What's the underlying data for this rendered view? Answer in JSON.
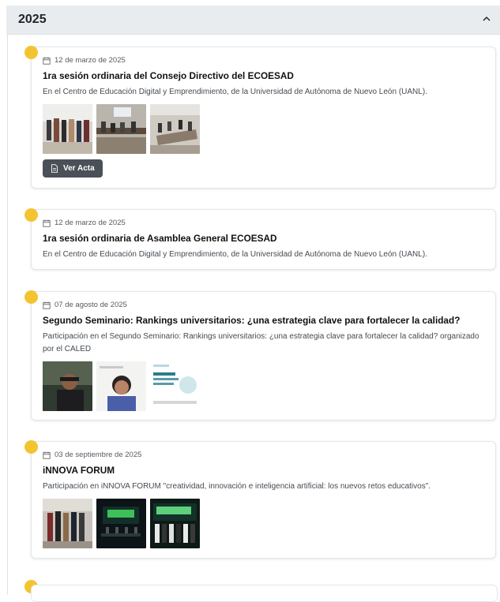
{
  "section": {
    "year": "2025"
  },
  "events": [
    {
      "date": "12 de marzo de 2025",
      "title": "1ra sesión ordinaria del Consejo Directivo del ECOESAD",
      "description": "En el Centro de Educación Digital y Emprendimiento, de la Universidad de Autónoma de Nuevo León (UANL).",
      "photo_count": 3,
      "button_label": "Ver Acta"
    },
    {
      "date": "12 de marzo de 2025",
      "title": "1ra sesión ordinaria de Asamblea General ECOESAD",
      "description": "En el Centro de Educación Digital y Emprendimiento, de la Universidad de Autónoma de Nuevo León (UANL)."
    },
    {
      "date": "07 de agosto de 2025",
      "title": "Segundo Seminario: Rankings universitarios: ¿una estrategia clave para fortalecer la calidad?",
      "description": "Participación en el Segundo Seminario: Rankings universitarios: ¿una estrategia clave para fortalecer la calidad? organizado por el CALED",
      "photo_count": 3
    },
    {
      "date": "03 de septiembre de 2025",
      "title": "iNNOVA FORUM",
      "description": "Participación en iNNOVA FORUM \"creatividad, innovación e inteligencia artificial: los nuevos retos educativos\".",
      "photo_count": 3
    }
  ],
  "colors": {
    "accent_dot": "#f4c430",
    "header_bg": "#e9ecef",
    "button_bg": "#4a5058"
  },
  "icons": {
    "header": "chevron-up-icon",
    "date": "calendar-icon",
    "button": "document-icon"
  }
}
